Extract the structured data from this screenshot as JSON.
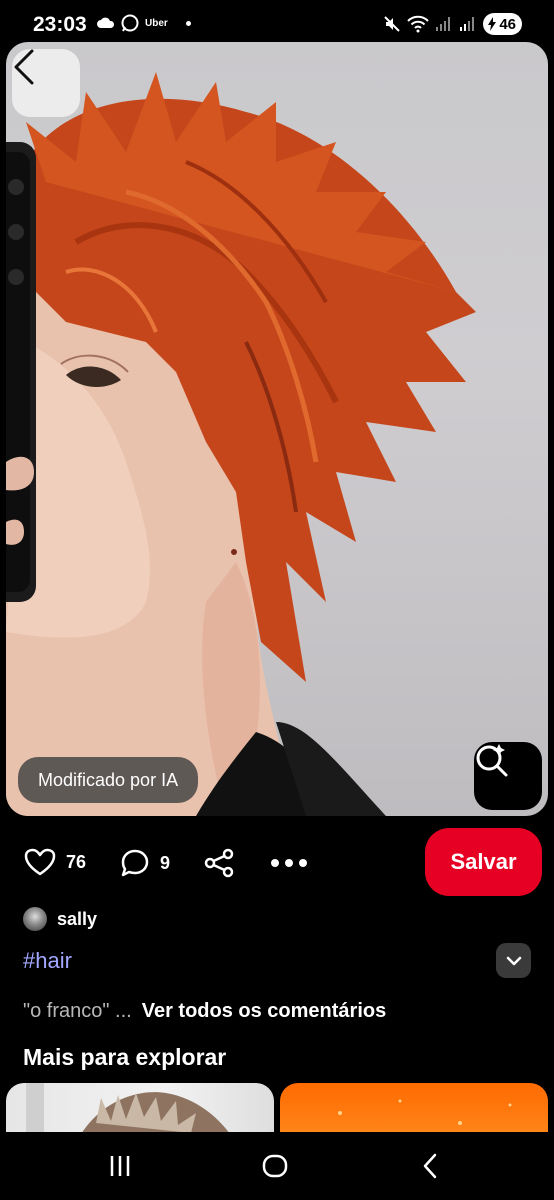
{
  "status_bar": {
    "time": "23:03",
    "uber": "Uber",
    "battery": "46"
  },
  "pin": {
    "ai_badge": "Modificado por IA",
    "likes": "76",
    "comments_count": "9",
    "save_label": "Salvar",
    "author": "sally",
    "hashtag": "#hair",
    "comment_snippet": "\"o franco\" ...",
    "all_comments": "Ver todos os comentários"
  },
  "explore": {
    "title": "Mais para explorar"
  },
  "colors": {
    "save": "#e60023",
    "hashtag": "#a2a8ff",
    "hair": "#c6461b"
  },
  "icons": [
    "back-icon",
    "lens-search-icon",
    "heart-icon",
    "comment-icon",
    "share-icon",
    "more-icon",
    "chevron-down-icon",
    "recent-apps-icon",
    "home-icon",
    "nav-back-icon",
    "wifi-icon",
    "mute-icon",
    "battery-icon"
  ]
}
